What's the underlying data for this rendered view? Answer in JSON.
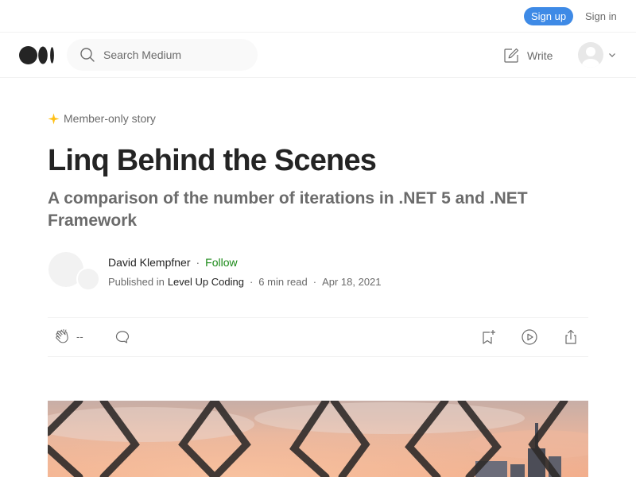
{
  "topbar": {
    "signup_label": "Sign up",
    "signin_label": "Sign in"
  },
  "navbar": {
    "logo_icon": "medium-logo-icon",
    "search": {
      "placeholder": "Search Medium",
      "icon": "search-icon"
    },
    "write_label": "Write",
    "write_icon": "write-icon",
    "avatar_icon": "user-avatar-icon"
  },
  "article": {
    "member_badge": "Member-only story",
    "title": "Linq Behind the Scenes",
    "subtitle": "A comparison of the number of iterations in .NET 5 and .NET Framework",
    "author": {
      "name": "David Klempfner",
      "follow_label": "Follow",
      "published_in_label": "Published in",
      "publication": "Level Up Coding",
      "read_time": "6 min read",
      "date": "Apr 18, 2021"
    },
    "actions": {
      "clap_count": "--",
      "icons": [
        "clap-icon",
        "comment-icon",
        "bookmark-icon",
        "listen-icon",
        "share-icon"
      ]
    }
  },
  "colors": {
    "accent_blue": "#3e8ae6",
    "follow_green": "#1a8917",
    "star": "#ffc017"
  }
}
